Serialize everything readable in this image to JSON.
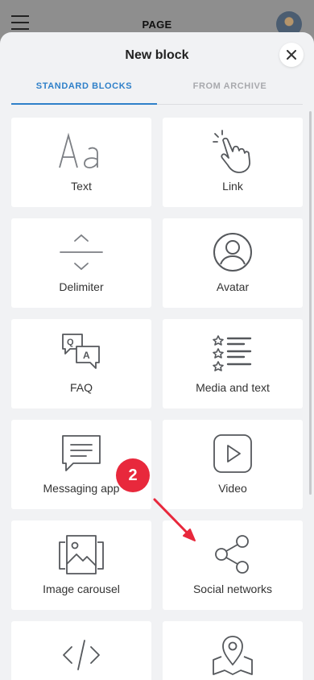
{
  "header": {
    "title": "PAGE"
  },
  "sheet": {
    "title": "New block",
    "tabs": [
      {
        "label": "STANDARD BLOCKS"
      },
      {
        "label": "FROM ARCHIVE"
      }
    ]
  },
  "blocks": [
    {
      "label": "Text",
      "icon": "text-aa-icon"
    },
    {
      "label": "Link",
      "icon": "pointer-hand-icon"
    },
    {
      "label": "Delimiter",
      "icon": "delimiter-icon"
    },
    {
      "label": "Avatar",
      "icon": "user-avatar-icon"
    },
    {
      "label": "FAQ",
      "icon": "faq-bubbles-icon"
    },
    {
      "label": "Media and text",
      "icon": "star-list-icon"
    },
    {
      "label": "Messaging app",
      "icon": "chat-bubble-icon"
    },
    {
      "label": "Video",
      "icon": "play-icon"
    },
    {
      "label": "Image carousel",
      "icon": "image-carousel-icon"
    },
    {
      "label": "Social networks",
      "icon": "share-icon"
    },
    {
      "label": "",
      "icon": "code-icon"
    },
    {
      "label": "",
      "icon": "map-pin-icon"
    }
  ],
  "annotation": {
    "step": "2",
    "color": "#e8283c"
  },
  "colors": {
    "accent": "#2f80c9",
    "icon_gray": "#7c7f84"
  }
}
